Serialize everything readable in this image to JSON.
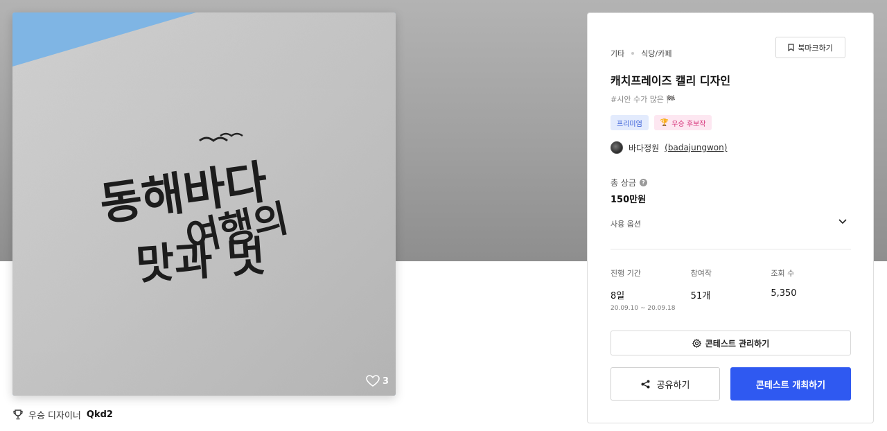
{
  "image": {
    "logo_text_lines": [
      "동해바다",
      "여행의",
      "맛과 멋"
    ],
    "like_count": "3"
  },
  "winner": {
    "label": "우승 디자이너",
    "name": "Qkd2"
  },
  "panel": {
    "breadcrumb": [
      "기타",
      "식당/카페"
    ],
    "bookmark_label": "북마크하기",
    "title": "캐치프레이즈 캘리 디자인",
    "tagline": "#시안 수가 많은 🏁",
    "badges": {
      "premium": "프리미엄",
      "award": "우승 후보작",
      "award_icon": "🏆"
    },
    "owner": {
      "name": "바다정원",
      "handle": "(badajungwon)"
    },
    "prize": {
      "label": "총 상금",
      "help": "?",
      "value": "150만원"
    },
    "usage_label": "사용 옵션",
    "stats": [
      {
        "label": "진행 기간",
        "value": "8일",
        "sub": "20.09.10  ~  20.09.18"
      },
      {
        "label": "참여작",
        "value": "51개",
        "sub": ""
      },
      {
        "label": "조회 수",
        "value": "5,350",
        "sub": ""
      }
    ],
    "manage_label": "콘테스트 관리하기",
    "share_label": "공유하기",
    "host_label": "콘테스트 개최하기"
  },
  "colors": {
    "primary": "#2f59f1",
    "premium_bg": "#e3ebfd",
    "award_bg": "#fde7f1"
  }
}
